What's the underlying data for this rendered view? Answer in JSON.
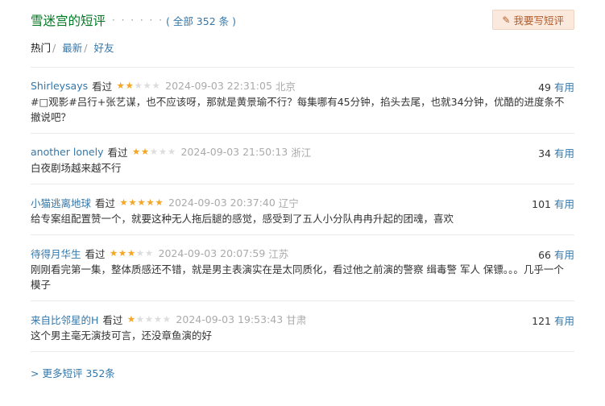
{
  "header": {
    "title": "雪迷宫的短评",
    "dots": "· · · · · ·",
    "count_label": "( 全部 352 条 )",
    "write_button": "我要写短评"
  },
  "tabs": [
    {
      "label": "热门",
      "active": true
    },
    {
      "label": "最新",
      "active": false
    },
    {
      "label": "好友",
      "active": false
    }
  ],
  "comments": [
    {
      "user": "Shirleysays",
      "status": "看过",
      "rating": 2,
      "time": "2024-09-03 22:31:05",
      "location": "北京",
      "votes": "49",
      "useful_label": "有用",
      "content": "#□观影#吕行+张艺谋，也不应该呀，那就是黄景瑜不行？每集哪有45分钟，掐头去尾，也就34分钟，优酷的进度条不撤说吧？"
    },
    {
      "user": "another lonely",
      "status": "看过",
      "rating": 2,
      "time": "2024-09-03 21:50:13",
      "location": "浙江",
      "votes": "34",
      "useful_label": "有用",
      "content": "白夜剧场越来越不行"
    },
    {
      "user": "小猫逃离地球",
      "status": "看过",
      "rating": 5,
      "time": "2024-09-03 20:37:40",
      "location": "辽宁",
      "votes": "101",
      "useful_label": "有用",
      "content": "给专案组配置赞一个，就要这种无人拖后腿的感觉，感受到了五人小分队冉冉升起的团魂，喜欢"
    },
    {
      "user": "待得月华生",
      "status": "看过",
      "rating": 3,
      "time": "2024-09-03 20:07:59",
      "location": "江苏",
      "votes": "66",
      "useful_label": "有用",
      "content": "刚刚看完第一集，整体质感还不错，就是男主表演实在是太同质化，看过他之前演的警察 缉毒警 军人 保镖。。。几乎一个模子"
    },
    {
      "user": "来自比邻星的H",
      "status": "看过",
      "rating": 1,
      "time": "2024-09-03 19:53:43",
      "location": "甘肃",
      "votes": "121",
      "useful_label": "有用",
      "content": "这个男主毫无演技可言，还没章鱼演的好"
    }
  ],
  "more_link": "> 更多短评 352条",
  "colors": {
    "title_green": "#007722",
    "link_blue": "#3377aa",
    "star_gold": "#f5a623",
    "button_bg": "#fbe9de"
  },
  "icons": {
    "write": "pencil-icon",
    "star_on": "star-filled-icon",
    "star_off": "star-empty-icon"
  }
}
